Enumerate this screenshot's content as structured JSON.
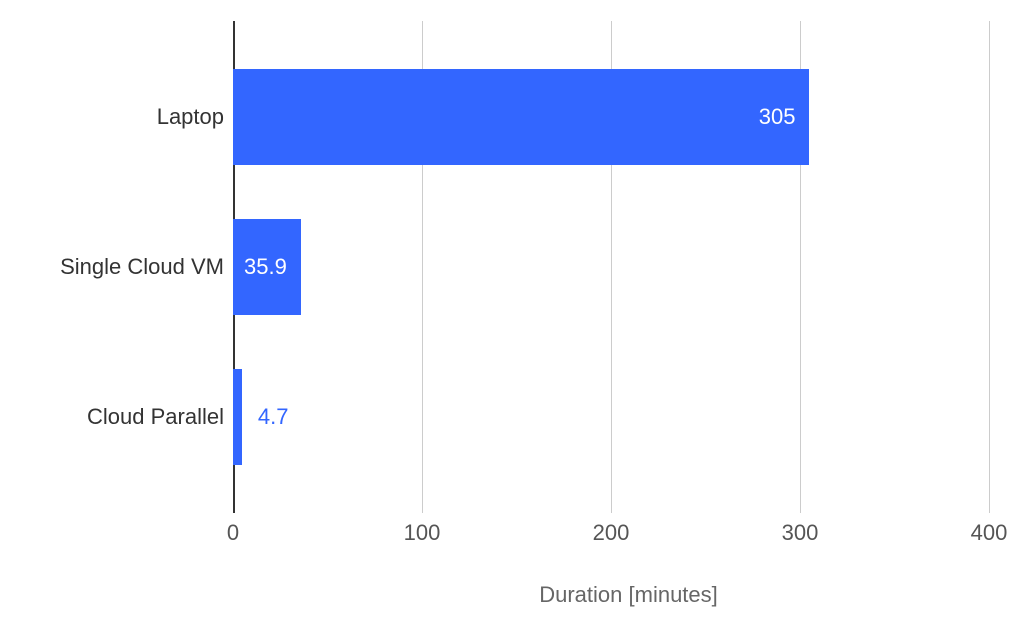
{
  "chart_data": {
    "type": "bar",
    "orientation": "horizontal",
    "categories": [
      "Laptop",
      "Single Cloud VM",
      "Cloud Parallel"
    ],
    "values": [
      305,
      35.9,
      4.7
    ],
    "xlabel": "Duration [minutes]",
    "ylabel": "",
    "xlim": [
      0,
      400
    ],
    "x_ticks": [
      0,
      100,
      200,
      300,
      400
    ],
    "grid": true,
    "bar_color": "#3366ff"
  }
}
